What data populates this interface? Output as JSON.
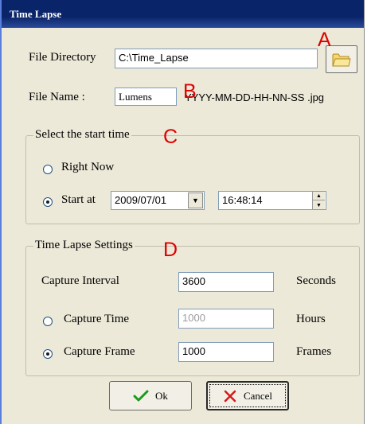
{
  "window": {
    "title": "Time Lapse"
  },
  "file_directory": {
    "label": "File Directory",
    "value": "C:\\Time_Lapse",
    "browse_icon": "folder-icon"
  },
  "file_name": {
    "label": "File Name :",
    "value": "Lumens",
    "suffix": "YYYY-MM-DD-HH-NN-SS .jpg"
  },
  "start_time": {
    "group_title": "Select the start time",
    "right_now_label": "Right Now",
    "start_at_label": "Start at",
    "selected": "start_at",
    "date": "2009/07/01",
    "time": "16:48:14"
  },
  "settings": {
    "group_title": "Time Lapse Settings",
    "capture_interval": {
      "label": "Capture Interval",
      "value": "3600",
      "unit": "Seconds"
    },
    "capture_time": {
      "label": "Capture Time",
      "value": "1000",
      "unit": "Hours",
      "enabled": false
    },
    "capture_frame": {
      "label": "Capture Frame",
      "value": "1000",
      "unit": "Frames",
      "selected": true
    }
  },
  "buttons": {
    "ok": "Ok",
    "cancel": "Cancel"
  },
  "annotations": {
    "a": "A",
    "b": "B",
    "c": "C",
    "d": "D"
  },
  "colors": {
    "title_bar": "#0a246a",
    "marker": "#e00000",
    "ok_check": "#1a9a1a",
    "cancel_x": "#d81818"
  }
}
